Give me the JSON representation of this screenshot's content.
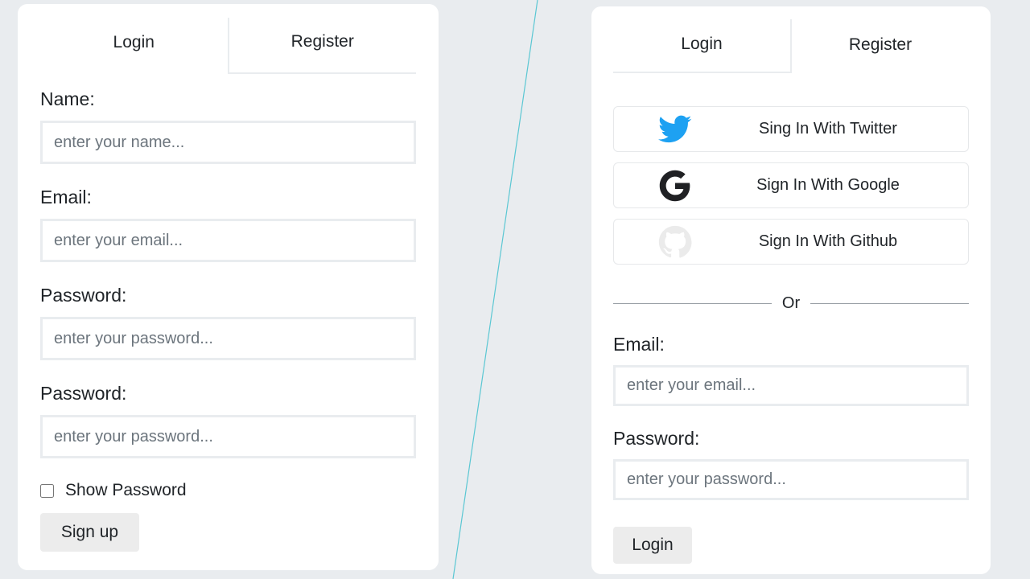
{
  "left_form": {
    "tabs": {
      "login": "Login",
      "register": "Register"
    },
    "name": {
      "label": "Name:",
      "placeholder": "enter your name..."
    },
    "email": {
      "label": "Email:",
      "placeholder": "enter your email..."
    },
    "password": {
      "label": "Password:",
      "placeholder": "enter your password..."
    },
    "confirm_password": {
      "label": "Password:",
      "placeholder": "enter your password..."
    },
    "show_password_label": "Show Password",
    "signup_label": "Sign up"
  },
  "right_form": {
    "tabs": {
      "login": "Login",
      "register": "Register"
    },
    "socials": [
      {
        "label": "Sing In With Twitter",
        "icon": "twitter-icon",
        "color": "#1da1f2"
      },
      {
        "label": "Sign In With Google",
        "icon": "google-icon",
        "color": "#202124"
      },
      {
        "label": "Sign In With Github",
        "icon": "github-icon",
        "color": "#ebebeb"
      }
    ],
    "or_text": "Or",
    "email": {
      "label": "Email:",
      "placeholder": "enter your email..."
    },
    "password": {
      "label": "Password:",
      "placeholder": "enter your password..."
    },
    "login_label": "Login"
  },
  "colors": {
    "background": "#e9ecef",
    "card": "#ffffff",
    "divider": "#5bc7d3",
    "button": "#ececec"
  }
}
